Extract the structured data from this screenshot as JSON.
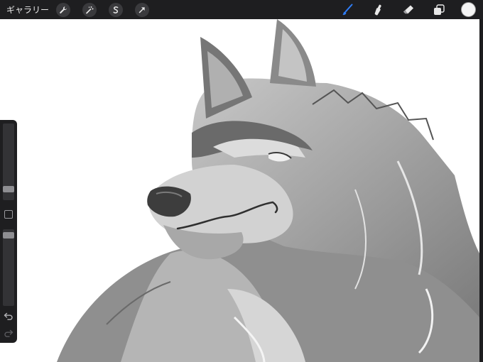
{
  "topbar": {
    "gallery_label": "ギャラリー",
    "left_tools": [
      {
        "name": "wrench-icon"
      },
      {
        "name": "magic-wand-icon"
      },
      {
        "name": "selection-s-icon"
      },
      {
        "name": "transform-arrow-icon"
      }
    ],
    "right_tools": [
      {
        "name": "brush-icon",
        "active": true
      },
      {
        "name": "smudge-icon"
      },
      {
        "name": "eraser-icon"
      },
      {
        "name": "layers-icon"
      }
    ],
    "active_tool_color": "#2f7df6",
    "current_color": "#f4f4f4"
  },
  "sidebar": {
    "brush_size_level": 0.12,
    "opacity_level": 0.95
  }
}
